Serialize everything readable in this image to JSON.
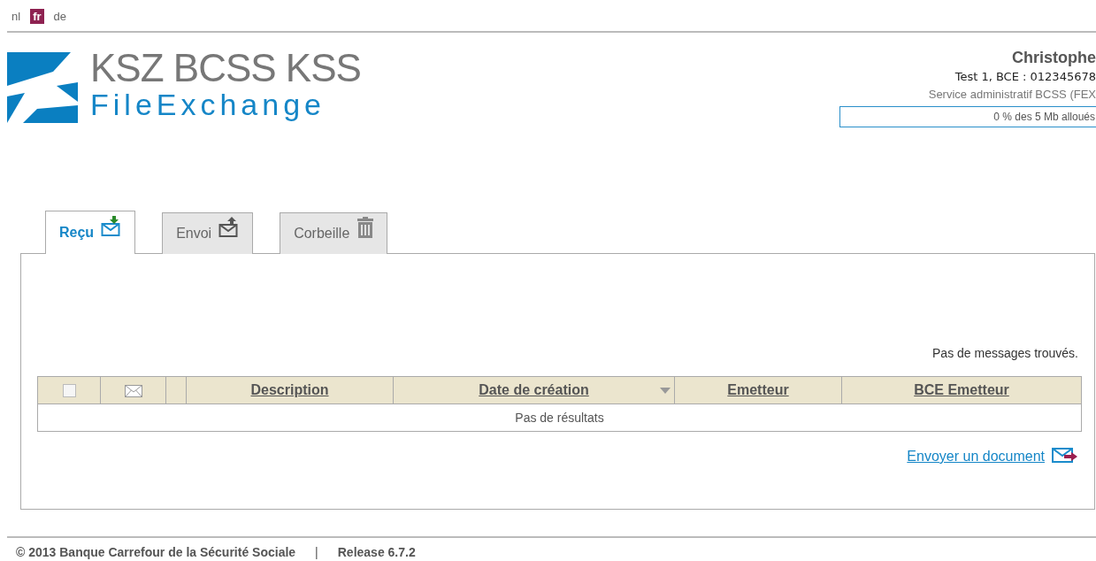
{
  "languages": [
    {
      "label": "nl",
      "selected": false
    },
    {
      "label": "fr",
      "selected": true
    },
    {
      "label": "de",
      "selected": false
    }
  ],
  "logo": {
    "title": "KSZ BCSS KSS",
    "subtitle": "FileExchange"
  },
  "user": {
    "name": "Christophe",
    "organisation": "Test 1, BCE : 012345678",
    "service": "Service administratif BCSS (FEX",
    "quota": {
      "label": "0 % des 5 Mb alloués",
      "level": 0
    }
  },
  "tabs": [
    {
      "label": "Reçu",
      "kind": "inbox",
      "selected": true
    },
    {
      "label": "Envoi",
      "kind": "outbox",
      "selected": false
    },
    {
      "label": "Corbeille",
      "kind": "trash",
      "selected": false
    }
  ],
  "message": "Pas de messages trouvés.",
  "table": {
    "select_all_checked": false,
    "columns": [
      {
        "kind": "checkbox"
      },
      {
        "kind": "envelope"
      },
      {
        "kind": "blank"
      },
      {
        "kind": "text",
        "label": "Description",
        "sorted": false
      },
      {
        "kind": "text",
        "label": "Date de création",
        "sorted": true
      },
      {
        "kind": "text",
        "label": "Emetteur",
        "sorted": false
      },
      {
        "kind": "text",
        "label": "BCE Emetteur",
        "sorted": false
      }
    ],
    "empty_text": "Pas de résultats"
  },
  "send_link": "Envoyer un document",
  "footer": {
    "copyright": "© 2013 Banque Carrefour de la Sécurité Sociale",
    "separator": "|",
    "release": "Release 6.7.2"
  }
}
